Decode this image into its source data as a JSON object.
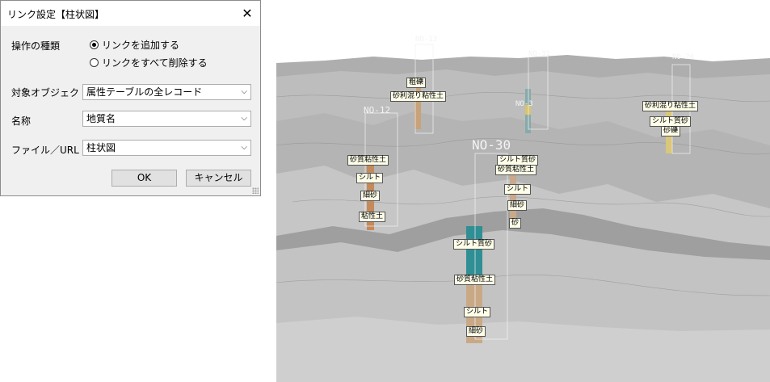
{
  "dialog": {
    "title": "リンク設定【柱状図】",
    "operation": {
      "label": "操作の種類",
      "options": [
        "リンクを追加する",
        "リンクをすべて削除する"
      ],
      "selected": 0
    },
    "target": {
      "label": "対象オブジェクト",
      "value": "属性テーブルの全レコード"
    },
    "name": {
      "label": "名称",
      "value": "地質名"
    },
    "file": {
      "label": "ファイル／URL",
      "value": "柱状図"
    },
    "ok": "OK",
    "cancel": "キャンセル"
  },
  "view": {
    "boreholes": [
      "NO-13",
      "NO-31",
      "NO-12",
      "NO-3",
      "NO-30",
      "NO-20"
    ],
    "labels": {
      "l1": "粗礫",
      "l2": "砂利混り粘性土",
      "l3": "砂利混り粘性土",
      "l4": "シルト質砂",
      "l5": "砂礫",
      "l6": "砂質粘性土",
      "l7": "シルト",
      "l8": "細砂",
      "l9": "粘性土",
      "l10": "シルト質砂",
      "l11": "砂質粘性土",
      "l12": "シルト",
      "l13": "細砂",
      "l14": "砂",
      "l15": "シルト質砂",
      "l16": "砂質粘性土",
      "l17": "シルト",
      "l18": "細砂"
    }
  }
}
